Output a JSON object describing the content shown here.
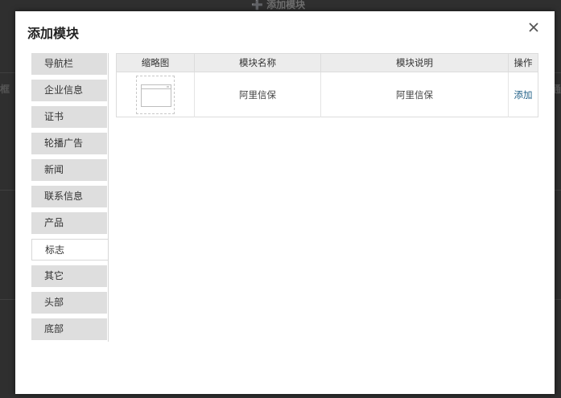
{
  "background": {
    "top_button": "➕ 添加模块",
    "left_fragment": "框",
    "right_fragment": "通"
  },
  "modal": {
    "title": "添加模块",
    "close_icon": "close-icon"
  },
  "sidebar": {
    "items": [
      {
        "label": "导航栏",
        "active": false
      },
      {
        "label": "企业信息",
        "active": false
      },
      {
        "label": "证书",
        "active": false
      },
      {
        "label": "轮播广告",
        "active": false
      },
      {
        "label": "新闻",
        "active": false
      },
      {
        "label": "联系信息",
        "active": false
      },
      {
        "label": "产品",
        "active": false
      },
      {
        "label": "标志",
        "active": true
      },
      {
        "label": "其它",
        "active": false
      },
      {
        "label": "头部",
        "active": false
      },
      {
        "label": "底部",
        "active": false
      }
    ]
  },
  "table": {
    "headers": [
      "缩略图",
      "模块名称",
      "模块说明",
      "操作"
    ],
    "rows": [
      {
        "name": "阿里信保",
        "description": "阿里信保",
        "action": "添加"
      }
    ]
  },
  "colors": {
    "overlay": "#2f2f2f",
    "nav_bg": "#dedede",
    "header_bg": "#ececec",
    "link": "#1f5f86"
  }
}
